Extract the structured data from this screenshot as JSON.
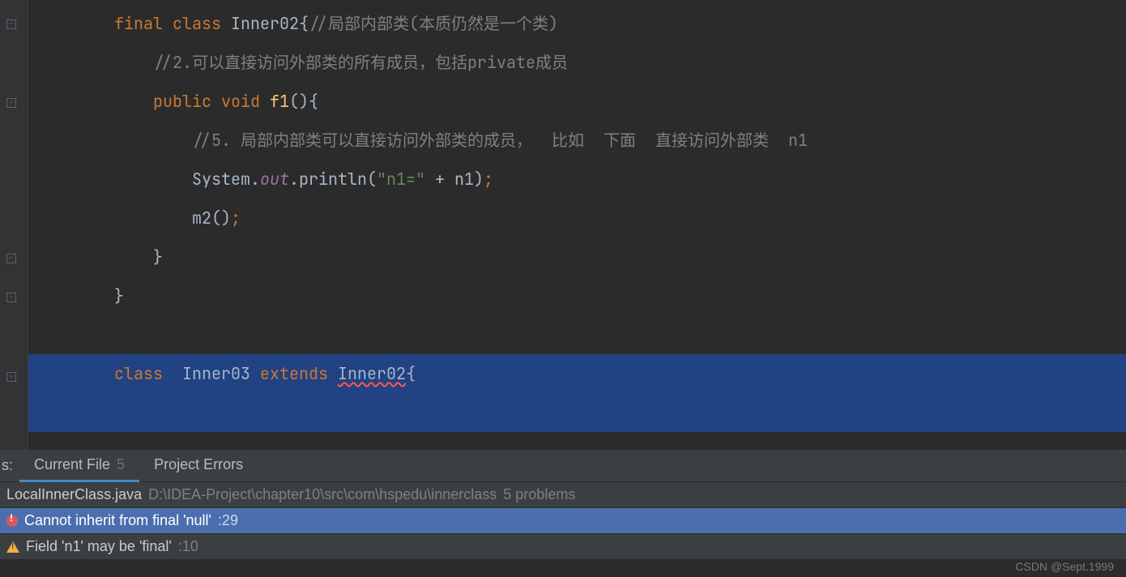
{
  "code": {
    "line1": {
      "indent": "        ",
      "kw1": "final",
      "kw2": "class",
      "className": "Inner02",
      "brace": "{",
      "comment": "//局部内部类(本质仍然是一个类)"
    },
    "line2": {
      "indent": "            ",
      "comment": "//2.可以直接访问外部类的所有成员，包括private成员"
    },
    "line3": {
      "indent": "            ",
      "kw1": "public",
      "kw2": "void",
      "method": "f1",
      "parens": "()",
      "brace": "{"
    },
    "line4": {
      "indent": "                ",
      "comment": "//5. 局部内部类可以直接访问外部类的成员，  比如  下面  直接访问外部类  n1"
    },
    "line5": {
      "indent": "                ",
      "sys": "System",
      "dot1": ".",
      "out": "out",
      "dot2": ".",
      "println": "println",
      "open": "(",
      "str": "\"n1=\"",
      "plus": " + ",
      "var": "n1",
      "close": ")",
      "semi": ";"
    },
    "line6": {
      "indent": "                ",
      "call": "m2",
      "parens": "()",
      "semi": ";"
    },
    "line7": {
      "indent": "            ",
      "brace": "}"
    },
    "line8": {
      "indent": "        ",
      "brace": "}"
    },
    "line10": {
      "indent": "        ",
      "kw1": "class",
      "space1": "  ",
      "className": "Inner03",
      "space2": " ",
      "kw2": "extends",
      "space3": " ",
      "super": "Inner02",
      "brace": "{"
    }
  },
  "tabs": {
    "leftLabel": "s:",
    "currentFile": "Current File",
    "currentCount": "5",
    "projectErrors": "Project Errors"
  },
  "problems": {
    "fileName": "LocalInnerClass.java",
    "filePath": "D:\\IDEA-Project\\chapter10\\src\\com\\hspedu\\innerclass",
    "fileCount": "5 problems",
    "error1": "Cannot inherit from final 'null'",
    "error1Line": ":29",
    "warn1": "Field 'n1' may be 'final'",
    "warn1Line": ":10"
  },
  "watermark": "CSDN @Sept.1999"
}
